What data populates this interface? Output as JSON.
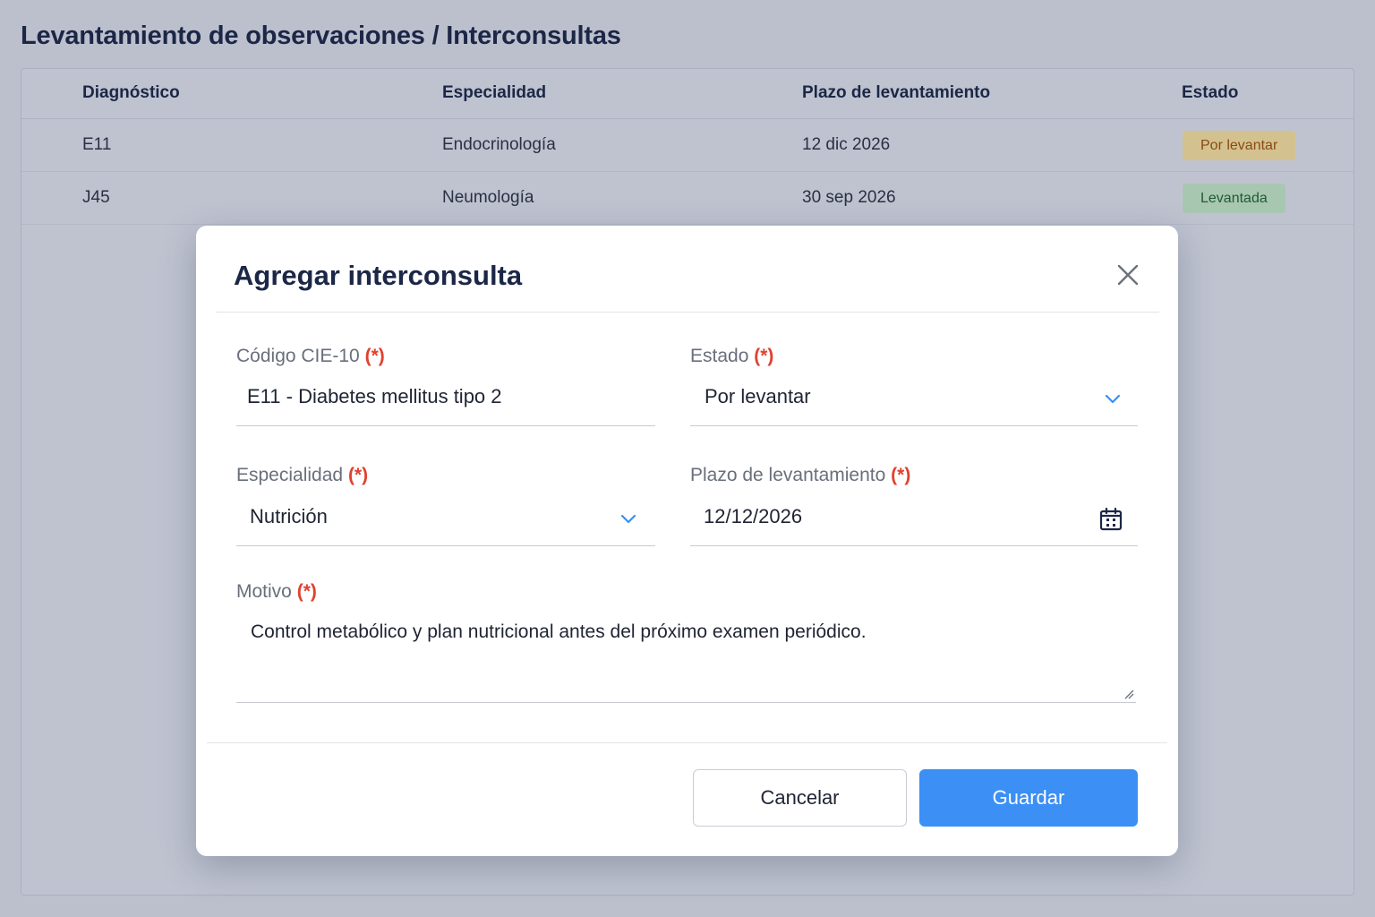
{
  "page": {
    "title": "Levantamiento de observaciones / Interconsultas"
  },
  "table": {
    "headers": [
      "Diagnóstico",
      "Especialidad",
      "Plazo de levantamiento",
      "Estado"
    ],
    "rows": [
      {
        "diagnostico": "E11",
        "especialidad": "Endocrinología",
        "plazo": "12 dic 2026",
        "estado": "Por levantar"
      },
      {
        "diagnostico": "J45",
        "especialidad": "Neumología",
        "plazo": "30 sep 2026",
        "estado": "Levantada"
      }
    ]
  },
  "modal": {
    "title": "Agregar interconsulta",
    "required_mark": "(*)",
    "fields": {
      "codigo": {
        "label": "Código CIE-10",
        "value": "E11 - Diabetes mellitus tipo 2"
      },
      "estado": {
        "label": "Estado",
        "value": "Por levantar"
      },
      "especialidad": {
        "label": "Especialidad",
        "value": "Nutrición"
      },
      "plazo": {
        "label": "Plazo de levantamiento",
        "value": "12/12/2026"
      },
      "motivo": {
        "label": "Motivo",
        "value": "Control metabólico y plan nutricional antes del próximo examen periódico."
      }
    },
    "buttons": {
      "cancel": "Cancelar",
      "save": "Guardar"
    }
  },
  "colors": {
    "accent": "#3b8ff5",
    "required": "#e0412f",
    "badge_pending_bg": "#d3c28f",
    "badge_done_bg": "#a8c7b1"
  },
  "icons": {
    "close": "close-icon",
    "dropdown": "chevron-down-icon",
    "calendar": "calendar-icon",
    "resize": "resize-handle-icon"
  }
}
